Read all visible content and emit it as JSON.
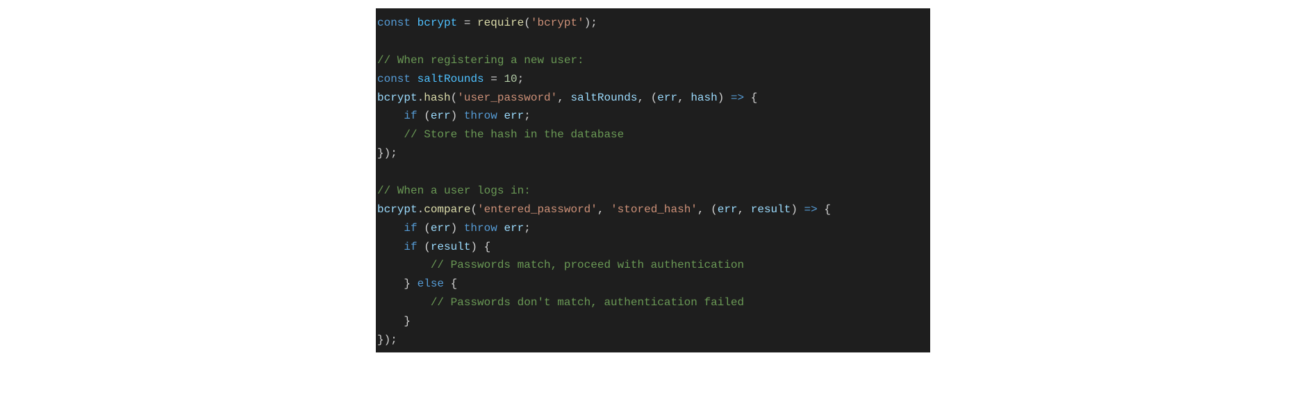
{
  "code": {
    "lines": [
      [
        {
          "cls": "kw",
          "t": "const"
        },
        {
          "cls": "op",
          "t": " "
        },
        {
          "cls": "varc",
          "t": "bcrypt"
        },
        {
          "cls": "op",
          "t": " = "
        },
        {
          "cls": "fn",
          "t": "require"
        },
        {
          "cls": "punct",
          "t": "("
        },
        {
          "cls": "str",
          "t": "'bcrypt'"
        },
        {
          "cls": "punct",
          "t": ");"
        }
      ],
      [
        {
          "cls": "op",
          "t": ""
        }
      ],
      [
        {
          "cls": "cmt",
          "t": "// When registering a new user:"
        }
      ],
      [
        {
          "cls": "kw",
          "t": "const"
        },
        {
          "cls": "op",
          "t": " "
        },
        {
          "cls": "varc",
          "t": "saltRounds"
        },
        {
          "cls": "op",
          "t": " = "
        },
        {
          "cls": "num",
          "t": "10"
        },
        {
          "cls": "punct",
          "t": ";"
        }
      ],
      [
        {
          "cls": "obj",
          "t": "bcrypt"
        },
        {
          "cls": "punct",
          "t": "."
        },
        {
          "cls": "fn",
          "t": "hash"
        },
        {
          "cls": "punct",
          "t": "("
        },
        {
          "cls": "str",
          "t": "'user_password'"
        },
        {
          "cls": "punct",
          "t": ", "
        },
        {
          "cls": "var",
          "t": "saltRounds"
        },
        {
          "cls": "punct",
          "t": ", ("
        },
        {
          "cls": "var",
          "t": "err"
        },
        {
          "cls": "punct",
          "t": ", "
        },
        {
          "cls": "var",
          "t": "hash"
        },
        {
          "cls": "punct",
          "t": ") "
        },
        {
          "cls": "arrow",
          "t": "=>"
        },
        {
          "cls": "punct",
          "t": " {"
        }
      ],
      [
        {
          "cls": "op",
          "t": "    "
        },
        {
          "cls": "kw",
          "t": "if"
        },
        {
          "cls": "punct",
          "t": " ("
        },
        {
          "cls": "var",
          "t": "err"
        },
        {
          "cls": "punct",
          "t": ") "
        },
        {
          "cls": "kw",
          "t": "throw"
        },
        {
          "cls": "op",
          "t": " "
        },
        {
          "cls": "var",
          "t": "err"
        },
        {
          "cls": "punct",
          "t": ";"
        }
      ],
      [
        {
          "cls": "op",
          "t": "    "
        },
        {
          "cls": "cmt",
          "t": "// Store the hash in the database"
        }
      ],
      [
        {
          "cls": "punct",
          "t": "});"
        }
      ],
      [
        {
          "cls": "op",
          "t": ""
        }
      ],
      [
        {
          "cls": "cmt",
          "t": "// When a user logs in:"
        }
      ],
      [
        {
          "cls": "obj",
          "t": "bcrypt"
        },
        {
          "cls": "punct",
          "t": "."
        },
        {
          "cls": "fn",
          "t": "compare"
        },
        {
          "cls": "punct",
          "t": "("
        },
        {
          "cls": "str",
          "t": "'entered_password'"
        },
        {
          "cls": "punct",
          "t": ", "
        },
        {
          "cls": "str",
          "t": "'stored_hash'"
        },
        {
          "cls": "punct",
          "t": ", ("
        },
        {
          "cls": "var",
          "t": "err"
        },
        {
          "cls": "punct",
          "t": ", "
        },
        {
          "cls": "var",
          "t": "result"
        },
        {
          "cls": "punct",
          "t": ") "
        },
        {
          "cls": "arrow",
          "t": "=>"
        },
        {
          "cls": "punct",
          "t": " {"
        }
      ],
      [
        {
          "cls": "op",
          "t": "    "
        },
        {
          "cls": "kw",
          "t": "if"
        },
        {
          "cls": "punct",
          "t": " ("
        },
        {
          "cls": "var",
          "t": "err"
        },
        {
          "cls": "punct",
          "t": ") "
        },
        {
          "cls": "kw",
          "t": "throw"
        },
        {
          "cls": "op",
          "t": " "
        },
        {
          "cls": "var",
          "t": "err"
        },
        {
          "cls": "punct",
          "t": ";"
        }
      ],
      [
        {
          "cls": "op",
          "t": "    "
        },
        {
          "cls": "kw",
          "t": "if"
        },
        {
          "cls": "punct",
          "t": " ("
        },
        {
          "cls": "var",
          "t": "result"
        },
        {
          "cls": "punct",
          "t": ") {"
        }
      ],
      [
        {
          "cls": "op",
          "t": "        "
        },
        {
          "cls": "cmt",
          "t": "// Passwords match, proceed with authentication"
        }
      ],
      [
        {
          "cls": "op",
          "t": "    "
        },
        {
          "cls": "punct",
          "t": "} "
        },
        {
          "cls": "kw",
          "t": "else"
        },
        {
          "cls": "punct",
          "t": " {"
        }
      ],
      [
        {
          "cls": "op",
          "t": "        "
        },
        {
          "cls": "cmt",
          "t": "// Passwords don't match, authentication failed"
        }
      ],
      [
        {
          "cls": "op",
          "t": "    "
        },
        {
          "cls": "punct",
          "t": "}"
        }
      ],
      [
        {
          "cls": "punct",
          "t": "});"
        }
      ]
    ]
  }
}
